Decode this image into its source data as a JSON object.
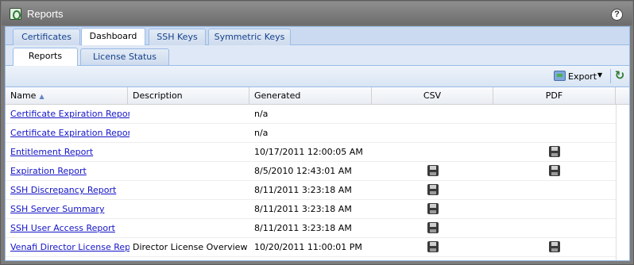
{
  "window": {
    "title": "Reports"
  },
  "tabs_primary": [
    {
      "label": "Certificates"
    },
    {
      "label": "Dashboard"
    },
    {
      "label": "SSH Keys"
    },
    {
      "label": "Symmetric Keys"
    }
  ],
  "tabs_secondary": [
    {
      "label": "Reports"
    },
    {
      "label": "License Status"
    }
  ],
  "toolbar": {
    "export_label": "Export"
  },
  "grid": {
    "columns": [
      "Name",
      "Description",
      "Generated",
      "CSV",
      "PDF"
    ],
    "rows": [
      {
        "name": "Certificate Expiration Report",
        "description": "",
        "generated": "n/a",
        "csv": false,
        "pdf": false
      },
      {
        "name": "Certificate Expiration Report",
        "description": "",
        "generated": "n/a",
        "csv": false,
        "pdf": false
      },
      {
        "name": "Entitlement Report",
        "description": "",
        "generated": "10/17/2011 12:00:05 AM",
        "csv": false,
        "pdf": true
      },
      {
        "name": "Expiration Report",
        "description": "",
        "generated": "8/5/2010 12:43:01 AM",
        "csv": true,
        "pdf": true
      },
      {
        "name": "SSH Discrepancy Report",
        "description": "",
        "generated": "8/11/2011 3:23:18 AM",
        "csv": true,
        "pdf": false
      },
      {
        "name": "SSH Server Summary",
        "description": "",
        "generated": "8/11/2011 3:23:18 AM",
        "csv": true,
        "pdf": false
      },
      {
        "name": "SSH User Access Report",
        "description": "",
        "generated": "8/11/2011 3:23:18 AM",
        "csv": true,
        "pdf": false
      },
      {
        "name": "Venafi Director License Rep...",
        "description": "Director License Overview",
        "generated": "10/20/2011 11:00:01 PM",
        "csv": true,
        "pdf": true
      }
    ]
  }
}
